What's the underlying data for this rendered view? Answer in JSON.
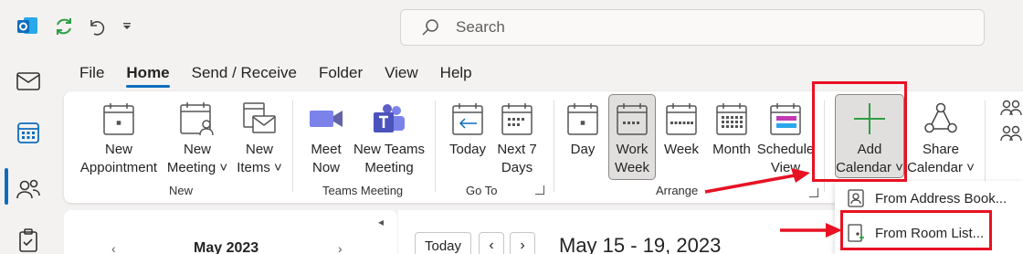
{
  "search": {
    "placeholder": "Search"
  },
  "menu": [
    "File",
    "Home",
    "Send / Receive",
    "Folder",
    "View",
    "Help"
  ],
  "ribbon": {
    "new_appointment": [
      "New",
      "Appointment"
    ],
    "new_meeting": [
      "New",
      "Meeting ˅"
    ],
    "new_items": [
      "New",
      "Items ˅"
    ],
    "meet_now": [
      "Meet",
      "Now"
    ],
    "new_teams_meeting": [
      "New Teams",
      "Meeting"
    ],
    "today": "Today",
    "next7": [
      "Next 7",
      "Days"
    ],
    "day": "Day",
    "work_week": [
      "Work",
      "Week"
    ],
    "week": "Week",
    "month": "Month",
    "schedule_view": [
      "Schedule",
      "View"
    ],
    "add_calendar": [
      "Add",
      "Calendar ˅"
    ],
    "share_calendar": [
      "Share",
      "Calendar ˅"
    ],
    "group_new": "New",
    "group_teams": "Teams Meeting",
    "group_goto": "Go To",
    "group_arrange": "Arrange"
  },
  "dropdown": {
    "from_address_book": "From Address Book...",
    "from_room_list": "From Room List..."
  },
  "calendar": {
    "mini_month": "May 2023",
    "today_button": "Today",
    "date_range": "May 15 - 19, 2023"
  },
  "colors": {
    "accent": "#0f6cbd",
    "highlight": "#e81123",
    "green": "#2e9e44"
  }
}
